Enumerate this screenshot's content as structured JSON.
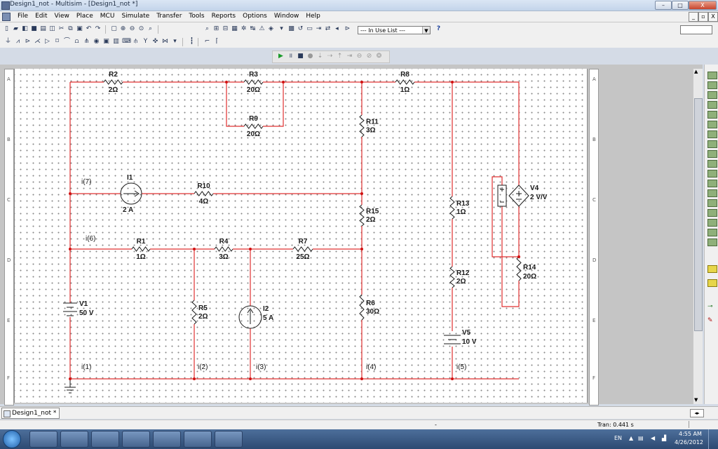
{
  "window": {
    "title": "Design1_not - Multisim - [Design1_not *]",
    "minimize": "–",
    "maximize": "□",
    "close": "X"
  },
  "menu": {
    "items": [
      "File",
      "Edit",
      "View",
      "Place",
      "MCU",
      "Simulate",
      "Transfer",
      "Tools",
      "Reports",
      "Options",
      "Window",
      "Help"
    ],
    "mdi_min": "_",
    "mdi_restore": "▫",
    "mdi_close": "X"
  },
  "toolbar": {
    "in_use_list": "--- In Use List ---",
    "help": "?"
  },
  "sheet": {
    "zones_rows": [
      "A",
      "B",
      "C",
      "D",
      "E",
      "F"
    ]
  },
  "circuit": {
    "components": [
      {
        "ref": "R2",
        "value": "2Ω"
      },
      {
        "ref": "R3",
        "value": "20Ω"
      },
      {
        "ref": "R9",
        "value": "20Ω"
      },
      {
        "ref": "R8",
        "value": "1Ω"
      },
      {
        "ref": "R11",
        "value": "3Ω"
      },
      {
        "ref": "I1",
        "value": "2 A"
      },
      {
        "ref": "R10",
        "value": "4Ω"
      },
      {
        "ref": "R15",
        "value": "2Ω"
      },
      {
        "ref": "R13",
        "value": "1Ω"
      },
      {
        "ref": "V4",
        "value": "2 V/V"
      },
      {
        "ref": "R1",
        "value": "1Ω"
      },
      {
        "ref": "R4",
        "value": "3Ω"
      },
      {
        "ref": "R7",
        "value": "25Ω"
      },
      {
        "ref": "R12",
        "value": "2Ω"
      },
      {
        "ref": "R14",
        "value": "20Ω"
      },
      {
        "ref": "V1",
        "value": "50 V"
      },
      {
        "ref": "R5",
        "value": "2Ω"
      },
      {
        "ref": "I2",
        "value": "5 A"
      },
      {
        "ref": "R6",
        "value": "30Ω"
      },
      {
        "ref": "V5",
        "value": "10 V"
      }
    ],
    "current_labels": [
      "i(7)",
      "i(6)",
      "i(1)",
      "i(2)",
      "i(3)",
      "i(4)",
      "i(5)"
    ]
  },
  "tabs": [
    {
      "label": "Design1_not *"
    }
  ],
  "status": {
    "transient": "Tran: 0.441 s"
  },
  "taskbar": {
    "language": "EN",
    "time": "4:55 AM",
    "date": "4/26/2012"
  },
  "colors": {
    "wire": "#e03030",
    "component": "#1a1a1a",
    "junction": "#d01010"
  }
}
